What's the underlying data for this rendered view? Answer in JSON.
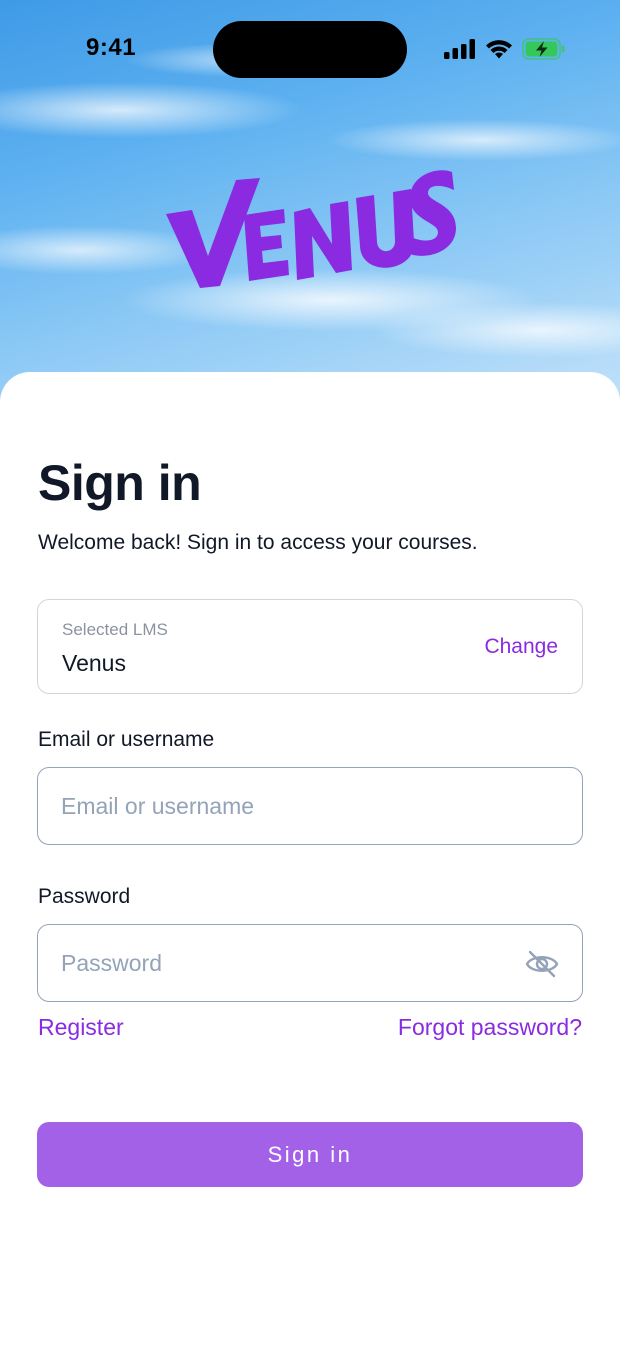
{
  "status_bar": {
    "time": "9:41",
    "icons": [
      "cellular-signal-icon",
      "wifi-icon",
      "battery-charging-icon"
    ]
  },
  "brand": {
    "logo_text": "VENUS",
    "logo_color": "#8a2be2"
  },
  "header": {
    "title": "Sign in",
    "subtitle": "Welcome back! Sign in to access your courses."
  },
  "lms": {
    "label": "Selected LMS",
    "value": "Venus",
    "change_label": "Change"
  },
  "email": {
    "label": "Email or username",
    "placeholder": "Email or username",
    "value": ""
  },
  "password": {
    "label": "Password",
    "placeholder": "Password",
    "value": "",
    "toggle_icon": "eye-off-icon"
  },
  "links": {
    "register": "Register",
    "forgot_password": "Forgot password?"
  },
  "submit": {
    "label": "Sign in"
  },
  "colors": {
    "accent": "#8a2be2",
    "button": "#a361e8",
    "text": "#111827",
    "placeholder": "#94a3b8",
    "battery": "#34c759"
  }
}
